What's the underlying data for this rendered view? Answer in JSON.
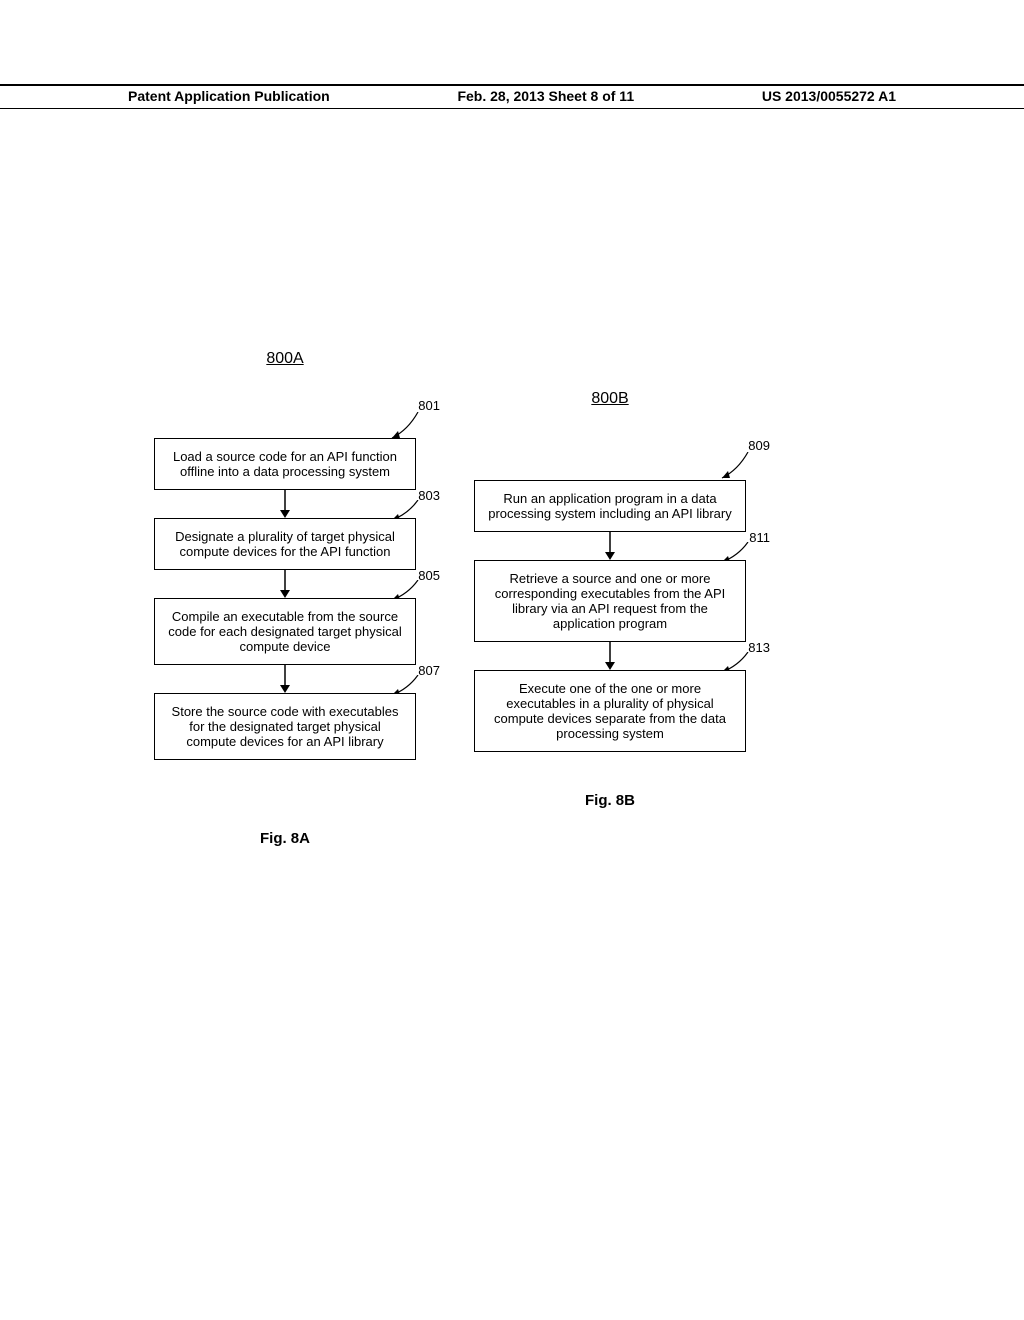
{
  "header": {
    "left": "Patent Application Publication",
    "center": "Feb. 28, 2013  Sheet 8 of 11",
    "right": "US 2013/0055272 A1"
  },
  "flowA": {
    "title": "800A",
    "ref1": "801",
    "box1": "Load a source code for an API function offline into a data processing system",
    "ref2": "803",
    "box2": "Designate a plurality of target physical compute devices for the API function",
    "ref3": "805",
    "box3": "Compile an executable from the source code for each designated target physical compute device",
    "ref4": "807",
    "box4": "Store the source code with executables for the designated target physical compute devices  for an API library",
    "caption": "Fig. 8A"
  },
  "flowB": {
    "title": "800B",
    "ref1": "809",
    "box1": "Run an application program in a data processing system including an API library",
    "ref2": "811",
    "box2": "Retrieve a source and one or more corresponding executables from the API library via  an API request from the application program",
    "ref3": "813",
    "box3": "Execute one of the one or more executables in a plurality of physical compute devices separate from the data processing system",
    "caption": "Fig. 8B"
  }
}
